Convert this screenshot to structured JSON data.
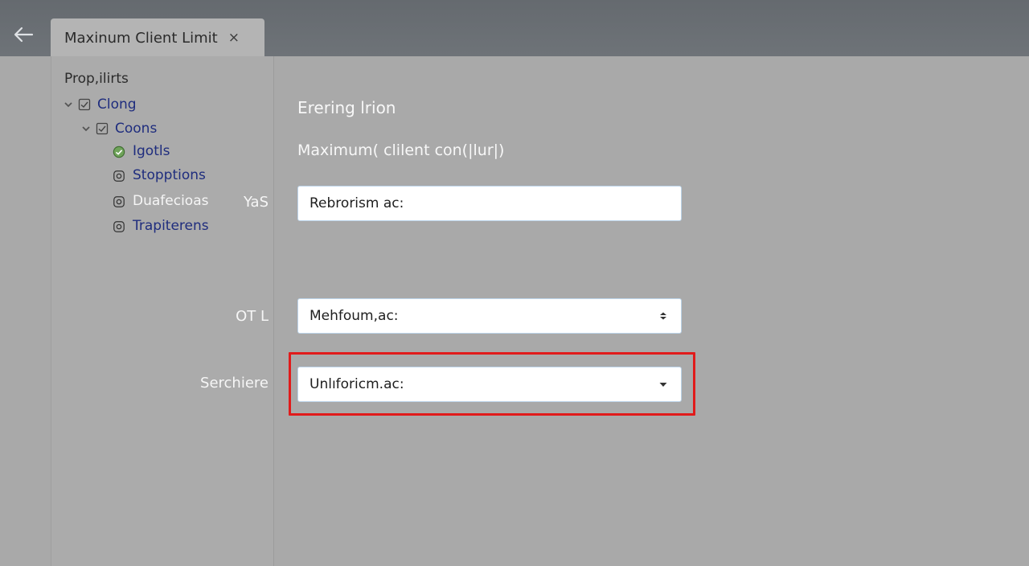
{
  "window": {
    "tab_title": "Maxinum Client Limit",
    "tab_close": "×"
  },
  "sidebar": {
    "title": "Prop,ilirts",
    "items": [
      {
        "label": "Clong",
        "icon": "checkbox-icon",
        "expanded": true
      },
      {
        "label": "Coons",
        "icon": "checkbox-icon",
        "expanded": true
      },
      {
        "label": "Igotls",
        "icon": "check-circle-icon"
      },
      {
        "label": "Stopptions",
        "icon": "settings-icon"
      },
      {
        "label": "Duafecioas",
        "icon": "settings-icon"
      },
      {
        "label": "Trapiterens",
        "icon": "settings-icon"
      }
    ]
  },
  "main": {
    "section_title": "Erering lrion",
    "section_subtitle": "Maximum( clilent con(|lur|)",
    "fields": [
      {
        "label": "YaS",
        "value": "Rebrorism ac:"
      },
      {
        "label": "OT L",
        "value": "Mehfoum,ac:",
        "control": "stepper"
      },
      {
        "label": "Serchiere",
        "value": "Unlıforicm.ac:",
        "control": "dropdown"
      }
    ]
  },
  "colors": {
    "topbar": "#6a6f74",
    "background": "#a9a9a9",
    "tree_link": "#1f2d7e",
    "highlight": "#e11b1b"
  }
}
